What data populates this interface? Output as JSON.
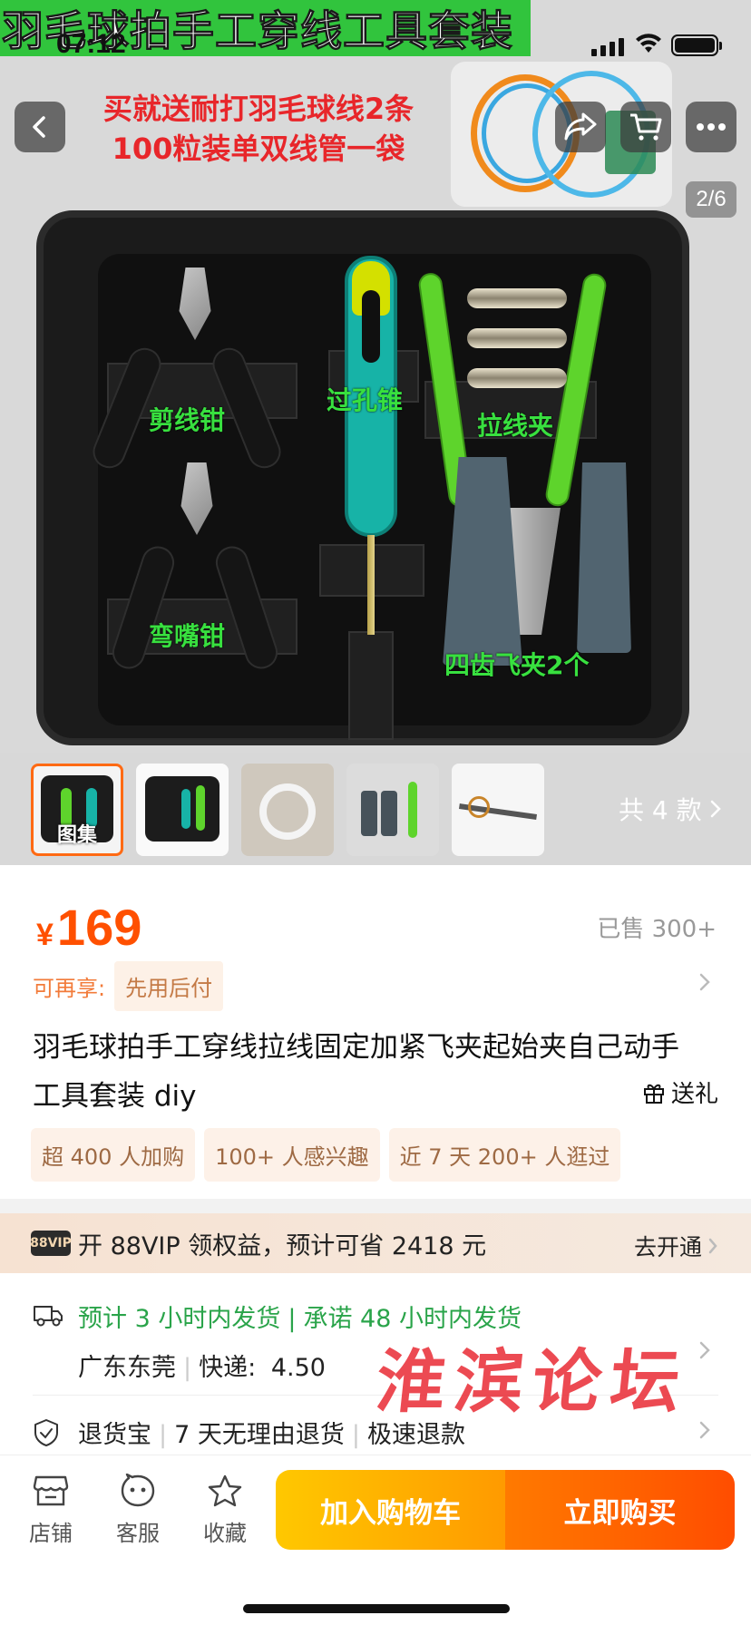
{
  "status_bar": {
    "time": "07:12"
  },
  "hero": {
    "banner_title": "羽毛球拍手工穿线工具套装",
    "promo_line1": "买就送耐打羽毛球线2条",
    "promo_line2": "100粒装单双线管一袋",
    "tool_labels": {
      "cutter": "剪线钳",
      "awl": "过孔锥",
      "clamp": "拉线夹",
      "bent_pliers": "弯嘴钳",
      "flying_clamp": "四齿飞夹2个"
    },
    "image_counter": "2/6"
  },
  "thumbnails": {
    "first_caption": "图集",
    "more_label": "共 4 款",
    "count": 5
  },
  "product": {
    "currency": "¥",
    "price": "169",
    "sold": "已售 300+",
    "enjoy_label": "可再享:",
    "enjoy_tag": "先用后付",
    "title": "羽毛球拍手工穿线拉线固定加紧飞夹起始夹自己动手工具套装 diy",
    "gift_label": "送礼",
    "chips": [
      "超 400 人加购",
      "100+ 人感兴趣",
      "近 7 天 200+ 人逛过"
    ]
  },
  "vip": {
    "badge": "88VIP",
    "text": "开 88VIP 领权益，预计可省 2418 元",
    "action": "去开通"
  },
  "shipping": {
    "promise_a": "预计 3 小时内发货",
    "promise_b": "承诺 48 小时内发货",
    "origin": "广东东莞",
    "express_label": "快递:",
    "express_fee": "4.50",
    "return_a": "退货宝",
    "return_b": "7 天无理由退货",
    "return_c": "极速退款"
  },
  "watermark": "淮滨论坛",
  "bottom_bar": {
    "store": "店铺",
    "service": "客服",
    "favorite": "收藏",
    "add_to_cart": "加入购物车",
    "buy_now": "立即购买"
  },
  "colors": {
    "accent": "#ff5000",
    "banner_green": "#31c43d",
    "label_green": "#38e03f",
    "ship_green": "#2aa44a",
    "watermark_red": "#e8232d"
  }
}
